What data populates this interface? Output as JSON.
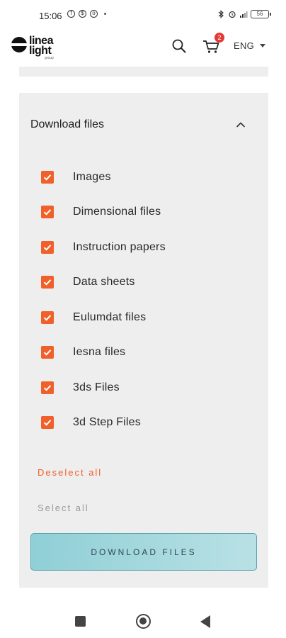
{
  "status_bar": {
    "time": "15:06",
    "battery": "56"
  },
  "header": {
    "logo_line1": "linea",
    "logo_line2": "light",
    "logo_sub": "group",
    "cart_count": "2",
    "language": "ENG",
    "accent_color": "#e53935"
  },
  "panel": {
    "title": "Download files",
    "checkbox_color": "#f0602a",
    "items": [
      {
        "label": "Images",
        "checked": true
      },
      {
        "label": "Dimensional files",
        "checked": true
      },
      {
        "label": "Instruction papers",
        "checked": true
      },
      {
        "label": "Data sheets",
        "checked": true
      },
      {
        "label": "Eulumdat files",
        "checked": true
      },
      {
        "label": "Iesna files",
        "checked": true
      },
      {
        "label": "3ds Files",
        "checked": true
      },
      {
        "label": "3d Step Files",
        "checked": true
      }
    ],
    "deselect_all": "Deselect all",
    "select_all": "Select all",
    "download_button": "DOWNLOAD FILES"
  },
  "icons": {
    "search": "search-icon",
    "cart": "cart-icon",
    "lang_caret": "chevron-down-icon",
    "collapse": "chevron-up-icon",
    "check": "checkmark-icon"
  }
}
